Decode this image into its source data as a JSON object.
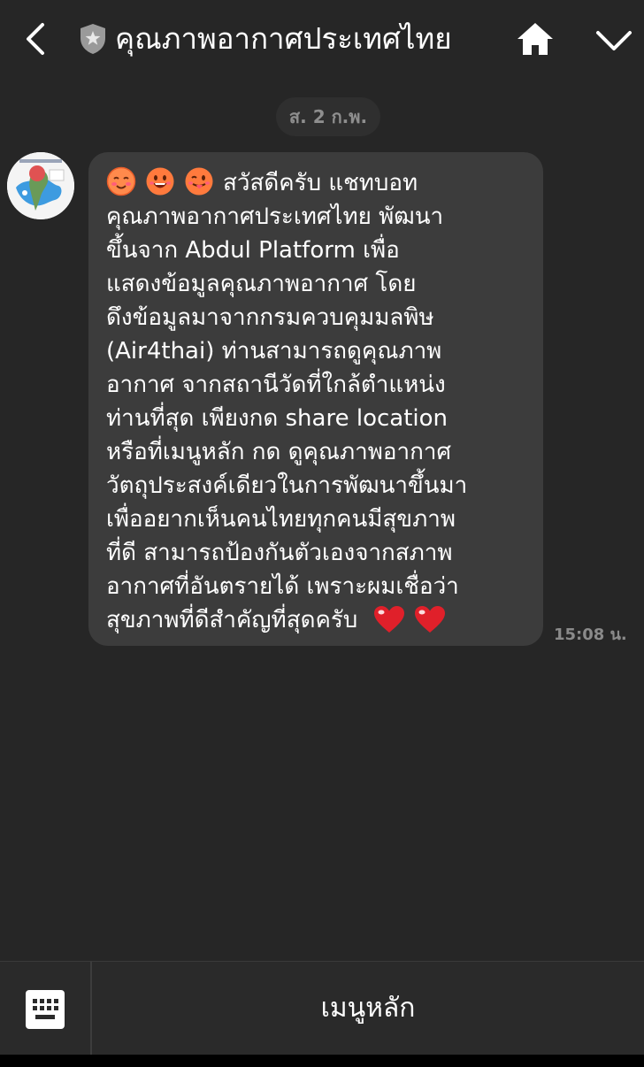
{
  "header": {
    "title": "คุณภาพอากาศประเทศไทย"
  },
  "chat": {
    "date_label": "ส. 2 ก.พ.",
    "message": {
      "lines": [
        "สวัสดีครับ แชทบอท",
        "คุณภาพอากาศประเทศไทย พัฒนา",
        "ขึ้นจาก Abdul Platform  เพื่อ",
        "แสดงข้อมูลคุณภาพอากาศ โดย",
        "ดึงข้อมูลมาจากกรมควบคุมมลพิษ",
        "(Air4thai)  ท่านสามารถดูคุณภาพ",
        "อากาศ จากสถานีวัดที่ใกล้ตำแหน่ง",
        "ท่านที่สุด เพียงกด share location",
        "หรือที่เมนูหลัก กด ดูคุณภาพอากาศ",
        "วัตถุประสงค์เดียวในการพัฒนาขึ้นมา",
        "เพื่ออยากเห็นคนไทยทุกคนมีสุขภาพ",
        "ที่ดี สามารถป้องกันตัวเองจากสภาพ",
        "อากาศที่อันตรายได้  เพราะผมเชื่อว่า",
        "สุขภาพที่ดีสำคัญที่สุดครับ"
      ],
      "leading_emojis": [
        "blush-emoji",
        "grin-emoji",
        "tongue-emoji"
      ],
      "trailing_emojis": [
        "heart-emoji",
        "heart-emoji"
      ],
      "time": "15:08 น."
    }
  },
  "bottom_bar": {
    "menu_label": "เมนูหลัก"
  },
  "colors": {
    "background": "#262626",
    "bubble": "#3c3c3c",
    "muted_text": "#8a8a8a",
    "heart": "#e0202a"
  }
}
